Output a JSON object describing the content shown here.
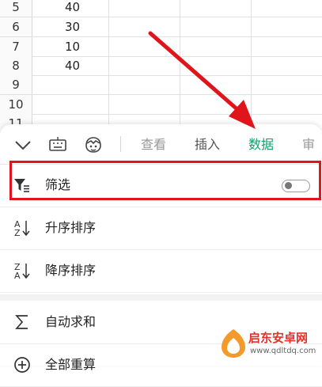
{
  "sheet": {
    "rows": [
      {
        "num": "5",
        "value": "40"
      },
      {
        "num": "6",
        "value": "30"
      },
      {
        "num": "7",
        "value": "10"
      },
      {
        "num": "8",
        "value": "40"
      },
      {
        "num": "9",
        "value": ""
      },
      {
        "num": "10",
        "value": ""
      },
      {
        "num": "11",
        "value": ""
      }
    ]
  },
  "toolbar": {
    "collapse_icon": "chevron-down-icon",
    "keyboard_icon": "keyboard-icon",
    "assistant_icon": "assistant-face-icon",
    "tabs": [
      {
        "label": "查看",
        "state": "muted"
      },
      {
        "label": "插入",
        "state": "normal"
      },
      {
        "label": "数据",
        "state": "active"
      },
      {
        "label": "审",
        "state": "muted"
      }
    ],
    "active_color": "#14a06c"
  },
  "menu": {
    "filter": {
      "label": "筛选",
      "icon": "filter-icon",
      "toggle_on": false
    },
    "sort_asc": {
      "label": "升序排序",
      "icon": "sort-ascending-icon"
    },
    "sort_desc": {
      "label": "降序排序",
      "icon": "sort-descending-icon"
    },
    "autosum": {
      "label": "自动求和",
      "icon": "sigma-icon"
    },
    "recalc": {
      "label": "全部重算",
      "icon": "recalc-icon"
    }
  },
  "annotation": {
    "highlight_color": "#e0151b"
  },
  "watermark": {
    "text": "启东安卓网",
    "url": "www.qdltdq.com"
  }
}
